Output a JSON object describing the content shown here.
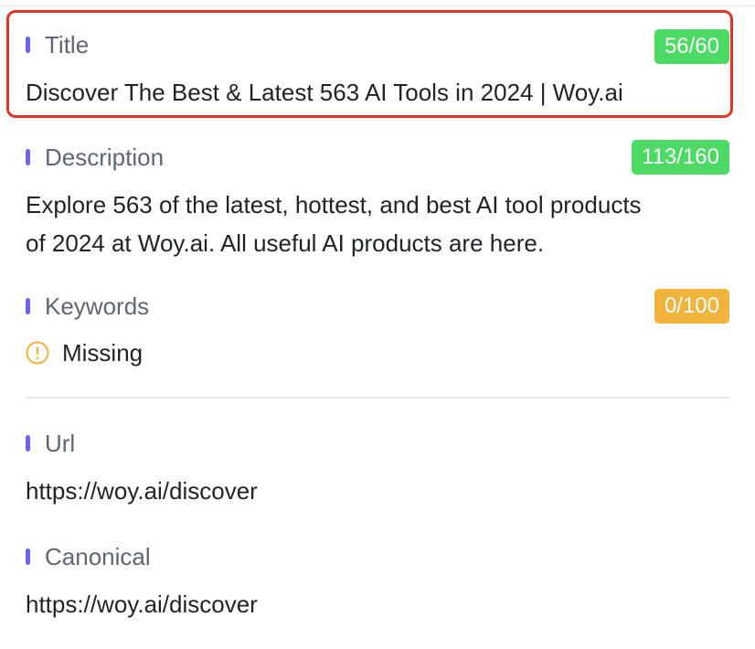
{
  "title": {
    "label": "Title",
    "count": "56/60",
    "value": "Discover The Best & Latest 563 AI Tools in 2024 | Woy.ai"
  },
  "description": {
    "label": "Description",
    "count": "113/160",
    "value_line1": "Explore 563 of the latest, hottest, and best AI tool products",
    "value_line2": "of 2024 at Woy.ai. All useful AI products are here."
  },
  "keywords": {
    "label": "Keywords",
    "count": "0/100",
    "status": "Missing",
    "status_icon": "warning-circle-icon"
  },
  "url": {
    "label": "Url",
    "value": "https://woy.ai/discover"
  },
  "canonical": {
    "label": "Canonical",
    "value": "https://woy.ai/discover"
  },
  "colors": {
    "accent_bar": "#6c63f0",
    "badge_ok": "#4cd964",
    "badge_warn": "#f0b43c",
    "highlight_border": "#e53222"
  }
}
